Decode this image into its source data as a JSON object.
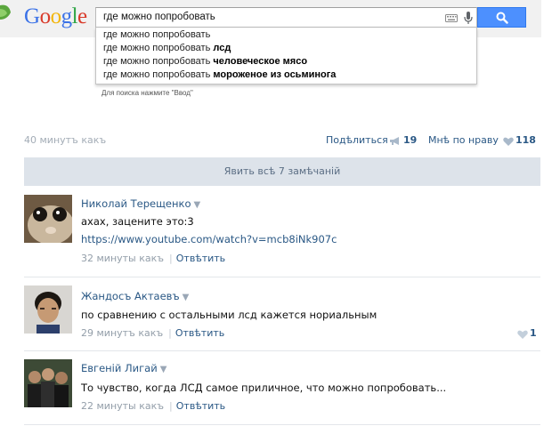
{
  "google": {
    "logo_letters": [
      {
        "char": "G",
        "color": "#3b72e7"
      },
      {
        "char": "o",
        "color": "#d93b2b"
      },
      {
        "char": "o",
        "color": "#f3b60c"
      },
      {
        "char": "g",
        "color": "#3b72e7"
      },
      {
        "char": "l",
        "color": "#2ea546"
      },
      {
        "char": "e",
        "color": "#d93b2b"
      }
    ],
    "query": "где можно попробовать",
    "suggestions": [
      {
        "base": "где можно попробовать",
        "bold": ""
      },
      {
        "base": "где можно попробовать ",
        "bold": "лсд"
      },
      {
        "base": "где можно попробовать ",
        "bold": "человеческое мясо"
      },
      {
        "base": "где можно попробовать ",
        "bold": "мороженое из осьминога"
      }
    ],
    "enter_hint": "Для поиска нажмите \"Ввод\"",
    "button_color": "#4d90fe"
  },
  "post": {
    "time": "40 минутъ какъ",
    "share_label": "Подѣлиться",
    "share_count": "19",
    "like_label": "Мнѣ по нраву",
    "like_count": "118",
    "show_all": "Явить всѣ 7 замѣчаній"
  },
  "comments": [
    {
      "name": "Николай Терещенко",
      "text": "ахах, заценитe это:3",
      "link": "https://www.youtube.com/watch?v=mcb8iNk907c",
      "date": "32 минуты какъ",
      "reply": "Отвѣтить",
      "likes": ""
    },
    {
      "name": "Жандосъ Актаевъ",
      "text": "по сравнению с остальными лсд кажется нориальным",
      "link": "",
      "date": "29 минутъ какъ",
      "reply": "Отвѣтить",
      "likes": "1"
    },
    {
      "name": "Евгеній Лигай",
      "text": "То чувство, когда ЛСД самое приличное, что можно попробовать...",
      "link": "",
      "date": "22 минуты какъ",
      "reply": "Отвѣтить",
      "likes": ""
    }
  ],
  "icons": {
    "search": "search-icon",
    "keyboard": "keyboard-icon",
    "microphone": "microphone-icon",
    "share": "megaphone-icon",
    "like": "heart-icon",
    "caret": "caret-down-icon"
  },
  "colors": {
    "link": "#2a5885",
    "muted": "#939ea9",
    "bar": "#dde3ea"
  }
}
